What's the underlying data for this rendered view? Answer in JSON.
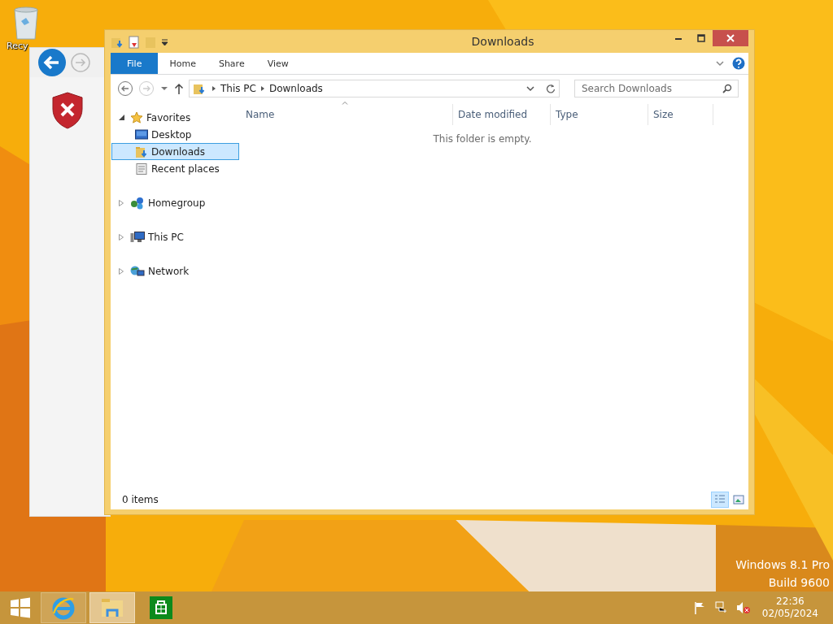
{
  "desktop": {
    "icons": [
      {
        "label": "Recy"
      }
    ],
    "watermark": [
      "Windows 8.1 Pro",
      "Build 9600"
    ]
  },
  "window": {
    "title": "Downloads",
    "ribbon_tabs": [
      {
        "label": "File",
        "kind": "file",
        "selected": false
      },
      {
        "label": "Home",
        "kind": "tab",
        "selected": false
      },
      {
        "label": "Share",
        "kind": "tab",
        "selected": false
      },
      {
        "label": "View",
        "kind": "tab",
        "selected": false
      }
    ],
    "breadcrumb": [
      "This PC",
      "Downloads"
    ],
    "search": {
      "placeholder": "Search Downloads"
    },
    "nav_tree": [
      {
        "label": "Favorites",
        "kind": "star",
        "expanded": true,
        "children": [
          {
            "label": "Desktop",
            "kind": "desktop",
            "selected": false
          },
          {
            "label": "Downloads",
            "kind": "downloads",
            "selected": true
          },
          {
            "label": "Recent places",
            "kind": "recent",
            "selected": false
          }
        ]
      },
      {
        "label": "Homegroup",
        "kind": "homegroup",
        "expanded": false
      },
      {
        "label": "This PC",
        "kind": "pc",
        "expanded": false
      },
      {
        "label": "Network",
        "kind": "network",
        "expanded": false
      }
    ],
    "columns": [
      {
        "label": "Name",
        "sorted": true
      },
      {
        "label": "Date modified",
        "sorted": false
      },
      {
        "label": "Type",
        "sorted": false
      },
      {
        "label": "Size",
        "sorted": false
      }
    ],
    "empty_message": "This folder is empty.",
    "status_bar": {
      "items": "0 items",
      "views": [
        {
          "kind": "details",
          "selected": true
        },
        {
          "kind": "large",
          "selected": false
        }
      ]
    }
  },
  "taskbar": {
    "apps": [
      {
        "kind": "ie",
        "selected": false
      },
      {
        "kind": "explorer",
        "selected": true
      },
      {
        "kind": "store",
        "selected": false
      }
    ],
    "time": "22:36",
    "date": "02/05/2024"
  }
}
